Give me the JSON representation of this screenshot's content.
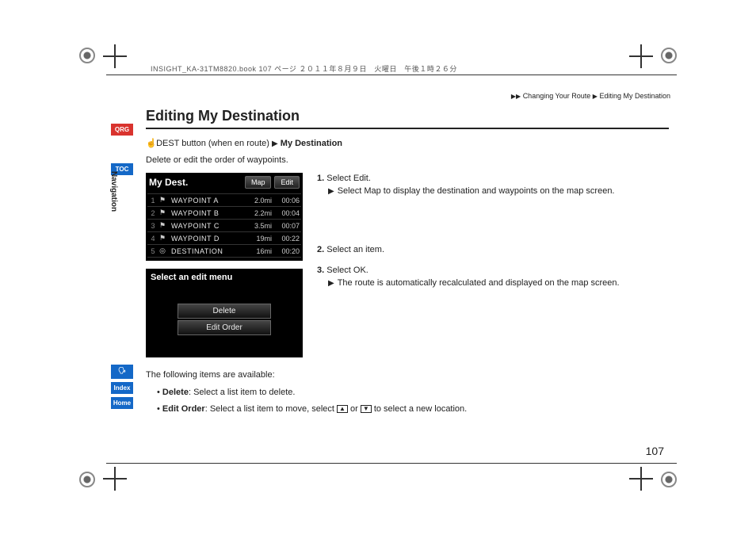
{
  "fileinfo": "INSIGHT_KA-31TM8820.book  107 ページ  ２０１１年８月９日　火曜日　午後１時２６分",
  "breadcrumb": {
    "a": "Changing Your Route",
    "b": "Editing My Destination"
  },
  "sidetabs": {
    "qrg": "QRG",
    "toc": "TOC",
    "voice": "",
    "index": "Index",
    "home": "Home"
  },
  "sidelabel": "Navigation",
  "h1": "Editing My Destination",
  "intro": {
    "line1a": "DEST button (when en route)",
    "line1b": "My Destination",
    "line2": "Delete or edit the order of waypoints."
  },
  "device1": {
    "title": "My Dest.",
    "tabs": {
      "map": "Map",
      "edit": "Edit"
    },
    "rows": [
      {
        "n": "1",
        "icon": "⚑",
        "name": "WAYPOINT A",
        "dist": "2.0mi",
        "time": "00:06"
      },
      {
        "n": "2",
        "icon": "⚑",
        "name": "WAYPOINT B",
        "dist": "2.2mi",
        "time": "00:04"
      },
      {
        "n": "3",
        "icon": "⚑",
        "name": "WAYPOINT C",
        "dist": "3.5mi",
        "time": "00:07"
      },
      {
        "n": "4",
        "icon": "⚑",
        "name": "WAYPOINT D",
        "dist": "19mi",
        "time": "00:22"
      },
      {
        "n": "5",
        "icon": "◎",
        "name": "DESTINATION",
        "dist": "16mi",
        "time": "00:20"
      }
    ]
  },
  "device2": {
    "title": "Select an edit menu",
    "delete": "Delete",
    "editorder": "Edit Order"
  },
  "steps": {
    "s1": {
      "num": "1.",
      "text_a": "Select ",
      "text_b": "Edit",
      "text_c": ".",
      "sub_a": "Select ",
      "sub_b": "Map",
      "sub_c": " to display the destination and waypoints on the map screen."
    },
    "s2": {
      "num": "2.",
      "text": "Select an item."
    },
    "s3": {
      "num": "3.",
      "text_a": "Select ",
      "text_b": "OK",
      "text_c": ".",
      "sub": "The route is automatically recalculated and displayed on the map screen."
    }
  },
  "below": {
    "intro": "The following items are available:",
    "b1_a": "Delete",
    "b1_b": ": Select a list item to delete.",
    "b2_a": "Edit Order",
    "b2_b": ": Select a list item to move, select ",
    "b2_c": " or ",
    "b2_d": " to select a new location."
  },
  "arrows": {
    "up": "▲",
    "down": "▼"
  },
  "pagenum": "107"
}
